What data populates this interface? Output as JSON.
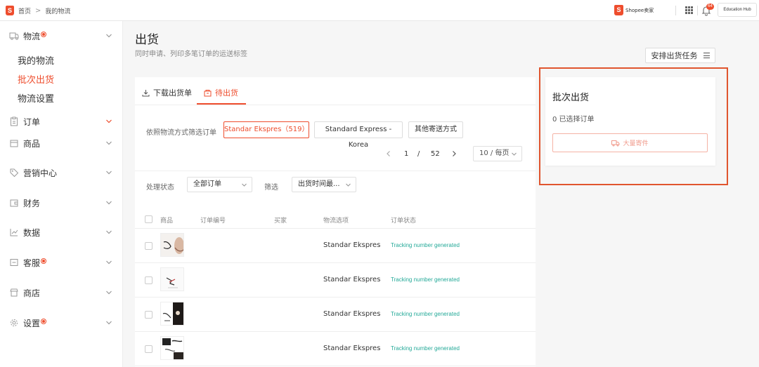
{
  "topbar": {
    "breadcrumb_home": "首页",
    "breadcrumb_sep": ">",
    "breadcrumb_current": "我的物流",
    "seller_brand": "Shopee卖家",
    "notification_count": "64",
    "account_label": "Education Hub",
    "logo_letter": "S"
  },
  "sidebar": {
    "logistics": "物流",
    "sub_items": [
      "我的物流",
      "批次出货",
      "物流设置"
    ],
    "orders": "订单",
    "products": "商品",
    "marketing": "营销中心",
    "finance": "财务",
    "data": "数据",
    "customer_service": "客服",
    "shop": "商店",
    "settings": "设置"
  },
  "header": {
    "title": "出货",
    "subtitle": "同时申请、列印多笔订单的运送标签",
    "arrange_button": "安排出货任务"
  },
  "tabs": {
    "download": "下载出货单",
    "pending": "待出货"
  },
  "filter": {
    "label": "依照物流方式筛选订单",
    "channels": [
      "Standar Ekspres（519）",
      "Standard Express - Korea",
      "其他寄送方式"
    ]
  },
  "pagination": {
    "current": "1",
    "slash": "/",
    "total": "52",
    "per_page": "10 / 每页"
  },
  "status_filter": {
    "status_label": "处理状态",
    "status_value": "全部订单",
    "sort_label": "筛选",
    "sort_value": "出货时间最..."
  },
  "table": {
    "headers": [
      "商品",
      "订单编号",
      "买家",
      "物流选项",
      "订单状态"
    ],
    "rows": [
      {
        "channel": "Standar Ekspres",
        "status": "Tracking number generated"
      },
      {
        "channel": "Standar Ekspres",
        "status": "Tracking number generated"
      },
      {
        "channel": "Standar Ekspres",
        "status": "Tracking number generated"
      },
      {
        "channel": "Standar Ekspres",
        "status": "Tracking number generated"
      }
    ]
  },
  "batch_card": {
    "title": "批次出货",
    "selected": "0 已选择订单",
    "bulk_button": "大量寄件"
  },
  "colors": {
    "brand": "#ee4d2d",
    "status_green": "#26aa99",
    "highlight": "#e0552e"
  }
}
